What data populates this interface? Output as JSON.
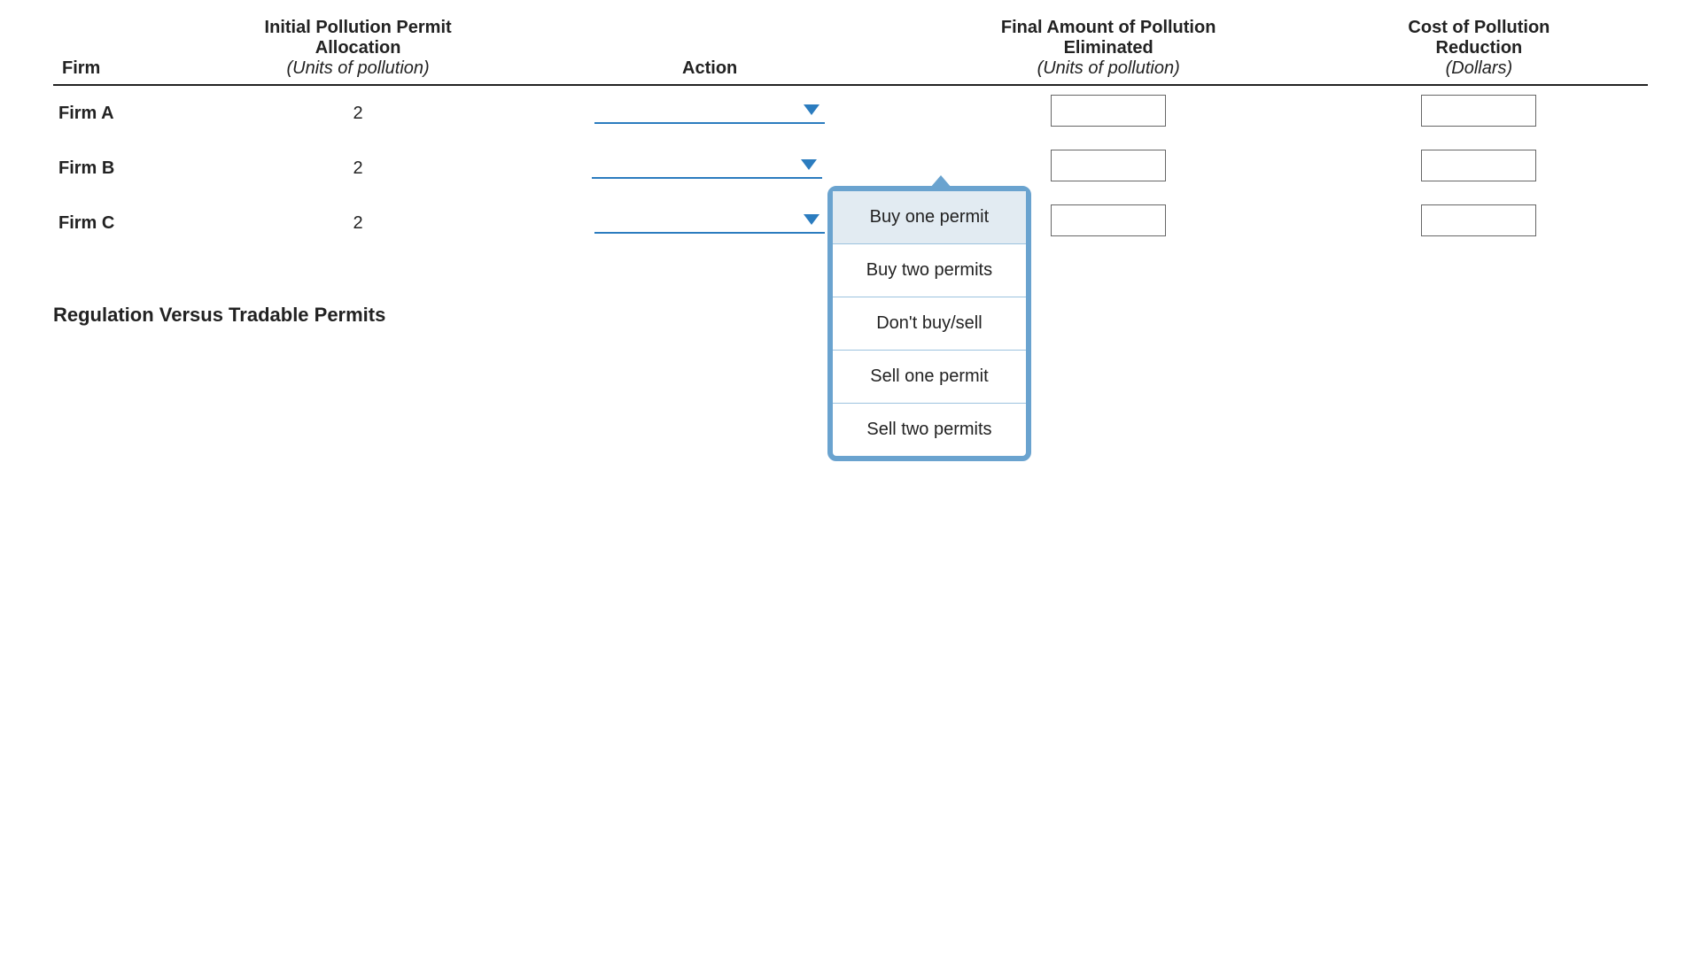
{
  "headers": {
    "firm": "Firm",
    "alloc_line1": "Initial Pollution Permit",
    "alloc_line2": "Allocation",
    "alloc_sub": "(Units of pollution)",
    "action": "Action",
    "final_line1": "Final Amount of Pollution",
    "final_line2": "Eliminated",
    "final_sub": "(Units of pollution)",
    "cost_line1": "Cost of Pollution",
    "cost_line2": "Reduction",
    "cost_sub": "(Dollars)"
  },
  "rows": [
    {
      "firm": "Firm A",
      "alloc": "2",
      "action": "",
      "final": "",
      "cost": ""
    },
    {
      "firm": "Firm B",
      "alloc": "2",
      "action": "",
      "final": "",
      "cost": ""
    },
    {
      "firm": "Firm C",
      "alloc": "2",
      "action": "",
      "final": "",
      "cost": ""
    }
  ],
  "dropdown_open_on_row": 1,
  "dropdown_options": [
    "Buy one permit",
    "Buy two permits",
    "Don't buy/sell",
    "Sell one permit",
    "Sell two permits"
  ],
  "dropdown_highlighted": 0,
  "section_title": "Regulation Versus Tradable Permits",
  "icons": {
    "caret_color": "#2b7cbf"
  }
}
